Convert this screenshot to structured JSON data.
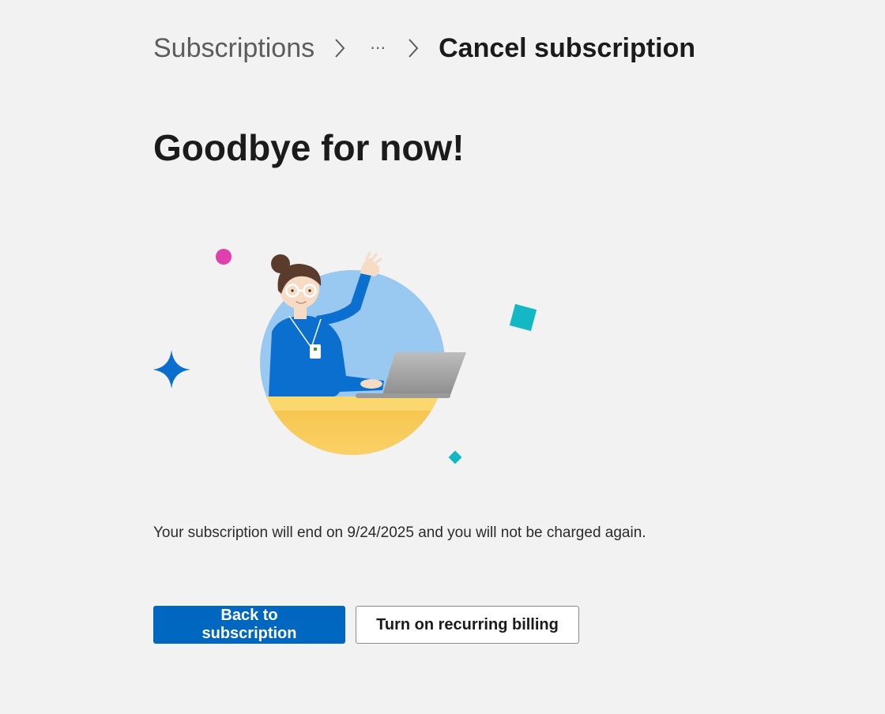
{
  "breadcrumb": {
    "items": [
      "Subscriptions",
      "Cancel subscription"
    ],
    "ellipsis": "⋯"
  },
  "page": {
    "title": "Goodbye for now!",
    "message": "Your subscription will end on 9/24/2025 and you will not be charged again."
  },
  "buttons": {
    "back_label": "Back to subscription",
    "billing_label": "Turn on recurring billing"
  },
  "colors": {
    "background": "#f2f2f2",
    "primary": "#0067c0",
    "illustration_circle": "#99c8f0",
    "desk": "#f7c84f",
    "accent_teal": "#14b8c4",
    "accent_pink": "#e03fae"
  },
  "illustration": {
    "name": "waving-person-laptop",
    "elements": [
      "sparkle-icon",
      "pink-dot",
      "teal-square",
      "teal-diamond",
      "person",
      "laptop"
    ]
  }
}
